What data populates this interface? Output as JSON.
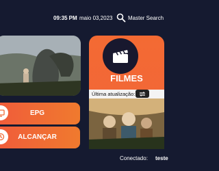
{
  "header": {
    "time": "09:35 PM",
    "date": "maio 03,2023",
    "search_label": "Master Search",
    "search_icon": "search-icon"
  },
  "menu": {
    "epg_label": "EPG",
    "epg_icon": "tv-guide-icon",
    "alcancar_label": "ALCANÇAR",
    "alcancar_icon": "catch-up-icon"
  },
  "movies": {
    "title": "FILMES",
    "icon": "clapperboard-icon",
    "last_update_label": "Última atualização:",
    "refresh_icon": "refresh-icon"
  },
  "footer": {
    "connected_label": "Conectado:",
    "connected_user": "teste"
  },
  "colors": {
    "background": "#151a30",
    "accent": "#f06a36",
    "text": "#ffffff"
  }
}
